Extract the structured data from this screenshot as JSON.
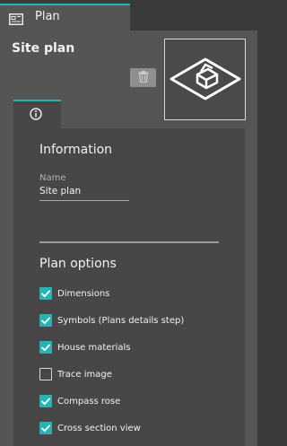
{
  "tabs": {
    "plan_label": "Plan"
  },
  "plan": {
    "title": "Site plan"
  },
  "information": {
    "heading": "Information",
    "name_label": "Name",
    "name_value": "Site plan"
  },
  "plan_options": {
    "heading": "Plan options",
    "items": [
      {
        "label": "Dimensions",
        "checked": true
      },
      {
        "label": "Symbols (Plans details step)",
        "checked": true
      },
      {
        "label": "House materials",
        "checked": true
      },
      {
        "label": "Trace image",
        "checked": false
      },
      {
        "label": "Compass rose",
        "checked": true
      },
      {
        "label": "Cross section view",
        "checked": true
      }
    ]
  },
  "colors": {
    "accent": "#2bb3b3",
    "panel": "#555555",
    "card": "#474747",
    "background": "#3a3a3a"
  },
  "icons": [
    "plan-icon",
    "trash-icon",
    "house-thumbnail-icon",
    "info-icon",
    "checkmark-icon"
  ]
}
